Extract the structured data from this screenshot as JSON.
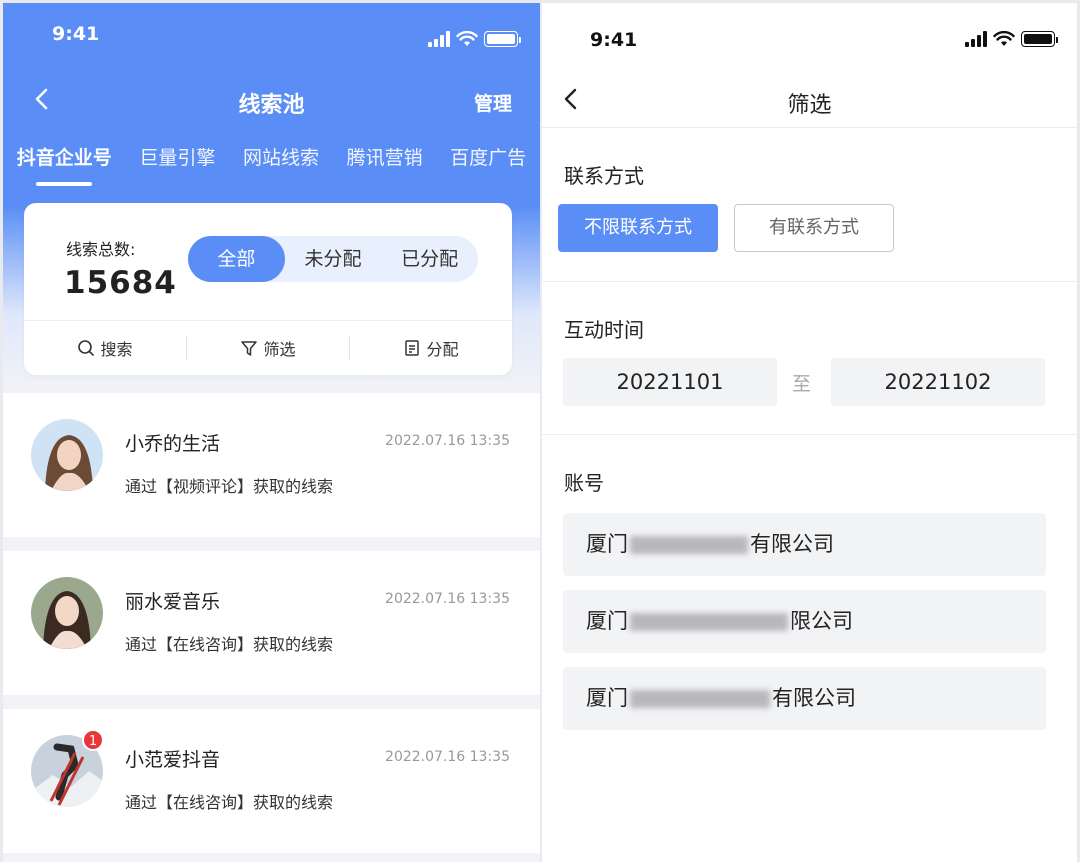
{
  "left": {
    "status": {
      "time": "9:41"
    },
    "nav": {
      "title": "线索池",
      "manage": "管理"
    },
    "tabs": [
      "抖音企业号",
      "巨量引擎",
      "网站线索",
      "腾讯营销",
      "百度广告"
    ],
    "summary": {
      "total_label": "线索总数:",
      "total_value": "15684",
      "segments": [
        "全部",
        "未分配",
        "已分配"
      ],
      "actions": {
        "search": "搜索",
        "filter": "筛选",
        "assign": "分配"
      }
    },
    "leads": [
      {
        "name": "小乔的生活",
        "time": "2022.07.16 13:35",
        "desc": "通过【视频评论】获取的线索"
      },
      {
        "name": "丽水爱音乐",
        "time": "2022.07.16 13:35",
        "desc": "通过【在线咨询】获取的线索"
      },
      {
        "name": "小范爱抖音",
        "time": "2022.07.16 13:35",
        "desc": "通过【在线咨询】获取的线索",
        "badge": "1"
      }
    ]
  },
  "right": {
    "status": {
      "time": "9:41"
    },
    "nav": {
      "title": "筛选"
    },
    "contact": {
      "title": "联系方式",
      "options": [
        "不限联系方式",
        "有联系方式"
      ]
    },
    "interaction": {
      "title": "互动时间",
      "start": "20221101",
      "to": "至",
      "end": "20221102"
    },
    "account": {
      "title": "账号",
      "items": [
        {
          "prefix": "厦门",
          "suffix": "有限公司"
        },
        {
          "prefix": "厦门",
          "suffix": "限公司"
        },
        {
          "prefix": "厦门",
          "suffix": "有限公司"
        }
      ]
    }
  },
  "colors": {
    "accent": "#5a8ef6",
    "badge": "#e8353a"
  }
}
